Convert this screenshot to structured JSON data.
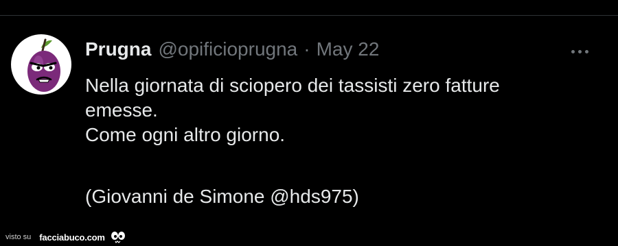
{
  "tweet": {
    "display_name": "Prugna",
    "handle": "@opificioprugna",
    "separator": "·",
    "date": "May 22",
    "body_lines": [
      "Nella giornata di sciopero dei tassisti zero fatture",
      "emesse.",
      "Come ogni altro giorno.",
      "",
      "(Giovanni de Simone @hds975)"
    ]
  },
  "footer": {
    "visto_su": "visto su",
    "site": "facciabuco.com"
  },
  "icons": {
    "more": "more-options-icon",
    "avatar": "plum-character-icon",
    "logo": "eyes-logo-icon"
  },
  "colors": {
    "background": "#000000",
    "primary_text": "#e7e9ea",
    "secondary_text": "#71767b",
    "avatar_plum": "#7b2a7a"
  }
}
